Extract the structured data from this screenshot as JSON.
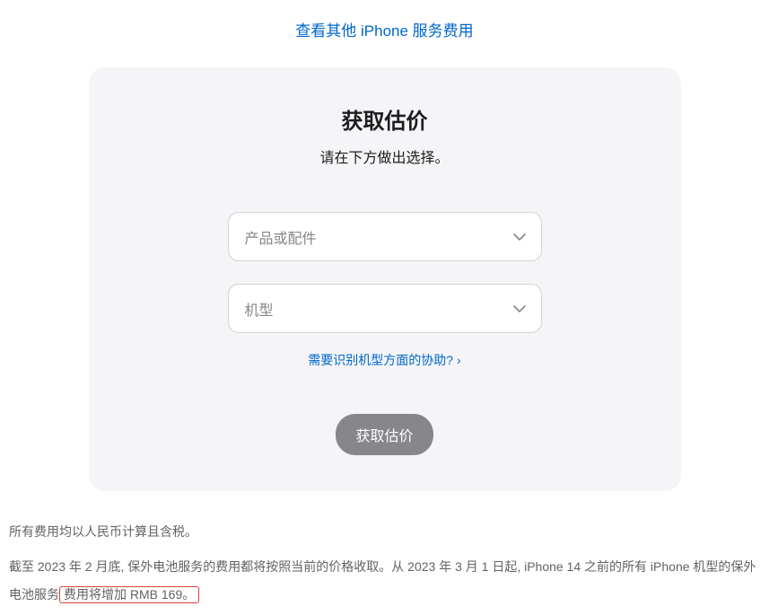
{
  "top_link": "查看其他 iPhone 服务费用",
  "card": {
    "title": "获取估价",
    "subtitle": "请在下方做出选择。",
    "select1_placeholder": "产品或配件",
    "select2_placeholder": "机型",
    "help_text": "需要识别机型方面的协助? ",
    "help_chevron": "›",
    "submit_label": "获取估价"
  },
  "footer": {
    "line1": "所有费用均以人民币计算且含税。",
    "line2_part1": "截至 2023 年 2 月底, 保外电池服务的费用都将按照当前的价格收取。从 2023 年 3 月 1 日起, iPhone 14 之前的所有 iPhone 机型的保外电池服务",
    "line2_highlight": "费用将增加 RMB 169。"
  }
}
